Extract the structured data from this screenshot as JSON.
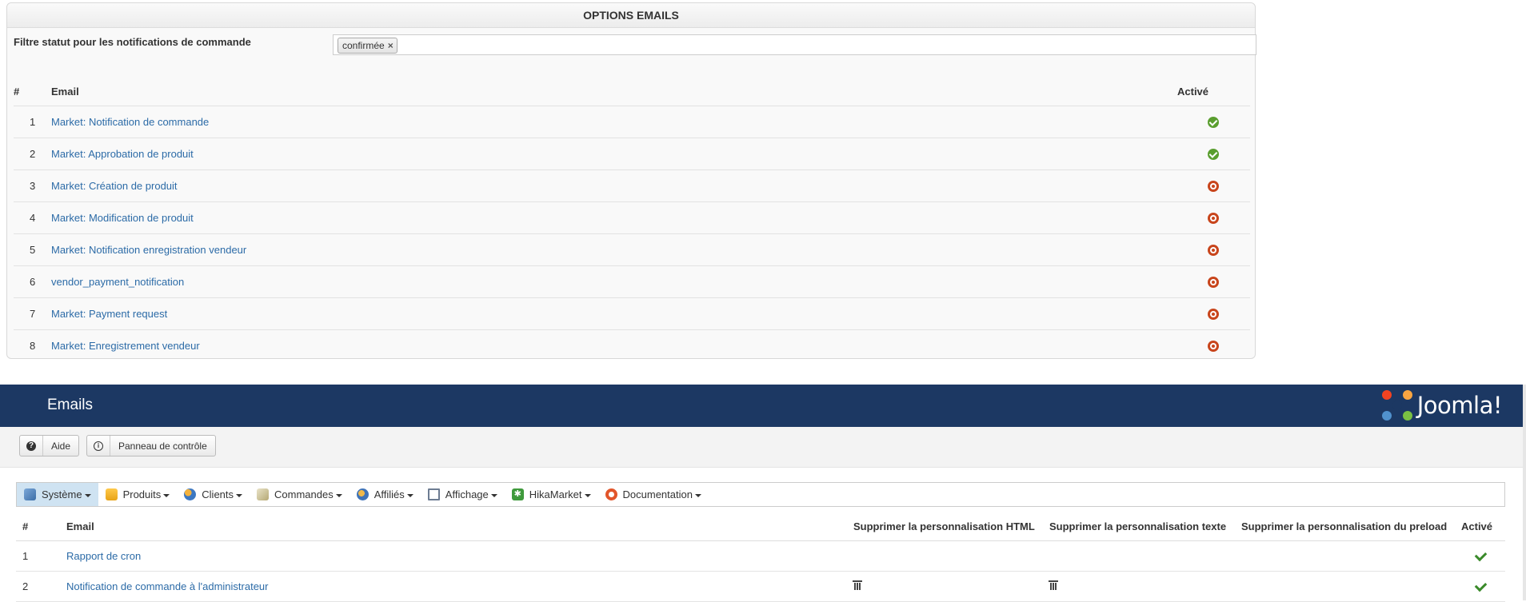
{
  "options_panel": {
    "title": "OPTIONS EMAILS",
    "filter_label": "Filtre statut pour les notifications de commande",
    "filter_chip": "confirmée",
    "chip_remove_symbol": "×",
    "columns": {
      "num": "#",
      "email": "Email",
      "active": "Activé"
    },
    "rows": [
      {
        "num": "1",
        "email": "Market: Notification de commande",
        "active": true
      },
      {
        "num": "2",
        "email": "Market: Approbation de produit",
        "active": true
      },
      {
        "num": "3",
        "email": "Market: Création de produit",
        "active": false
      },
      {
        "num": "4",
        "email": "Market: Modification de produit",
        "active": false
      },
      {
        "num": "5",
        "email": "Market: Notification enregistration vendeur",
        "active": false
      },
      {
        "num": "6",
        "email": "vendor_payment_notification",
        "active": false
      },
      {
        "num": "7",
        "email": "Market: Payment request",
        "active": false
      },
      {
        "num": "8",
        "email": "Market: Enregistrement vendeur",
        "active": false
      }
    ]
  },
  "header": {
    "title": "Emails",
    "logo_text": "Joomla!",
    "bg_color": "#1c3863"
  },
  "toolbar": {
    "help_label": "Aide",
    "help_icon": "question-circle-icon",
    "control_panel_label": "Panneau de contrôle",
    "control_panel_icon": "info-circle-icon"
  },
  "menu": {
    "items": [
      {
        "label": "Système",
        "icon": "tools-icon"
      },
      {
        "label": "Produits",
        "icon": "products-icon"
      },
      {
        "label": "Clients",
        "icon": "users-icon"
      },
      {
        "label": "Commandes",
        "icon": "orders-icon"
      },
      {
        "label": "Affiliés",
        "icon": "affiliates-icon"
      },
      {
        "label": "Affichage",
        "icon": "display-icon"
      },
      {
        "label": "HikaMarket",
        "icon": "hikamarket-icon"
      },
      {
        "label": "Documentation",
        "icon": "lifebuoy-icon"
      }
    ]
  },
  "emails_table": {
    "columns": {
      "num": "#",
      "email": "Email",
      "del_html": "Supprimer la personnalisation HTML",
      "del_text": "Supprimer la personnalisation texte",
      "del_preload": "Supprimer la personnalisation du preload",
      "active": "Activé"
    },
    "rows": [
      {
        "num": "1",
        "email": "Rapport de cron",
        "del_html": false,
        "del_text": false,
        "active": true
      },
      {
        "num": "2",
        "email": "Notification de commande à l'administrateur",
        "del_html": true,
        "del_text": true,
        "active": true
      }
    ]
  },
  "colors": {
    "link": "#2c6ba7",
    "enabled": "#5a9e2f",
    "disabled": "#c8451c",
    "menu_active": "#cfe3f2"
  }
}
